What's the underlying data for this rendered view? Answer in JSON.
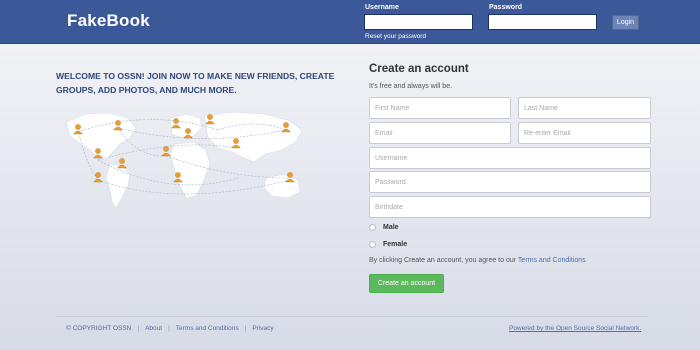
{
  "header": {
    "logo": "FakeBook",
    "username_label": "Username",
    "password_label": "Password",
    "username_value": "",
    "password_value": "",
    "reset_link": "Reset your password",
    "login_button": "Login",
    "bg_color": "#3b5998"
  },
  "welcome": {
    "text": "WELCOME TO OSSN! JOIN NOW TO MAKE NEW FRIENDS, CREATE GROUPS, ADD PHOTOS, AND MUCH MORE."
  },
  "signup": {
    "title": "Create an account",
    "subtitle": "It's free and always will be.",
    "first_name_placeholder": "First Name",
    "last_name_placeholder": "Last Name",
    "email_placeholder": "Email",
    "reenter_email_placeholder": "Re-enter Email",
    "username_placeholder": "Username",
    "password_placeholder": "Password",
    "birthdate_placeholder": "Birthdate",
    "gender_options": [
      "Male",
      "Female"
    ],
    "terms_prefix": "By clicking Create an account, you agree to our",
    "terms_link": "Terms and Conditions",
    "create_button": "Create an account",
    "create_button_color": "#5cb85c"
  },
  "footer": {
    "copyright": "© COPYRIGHT OSSN",
    "links": [
      "About",
      "Terms and Conditions",
      "Privacy"
    ],
    "separator": "|",
    "powered_by": "Powered by the Open Source Social Network."
  },
  "icons": {
    "map": "world-map-icon",
    "person": "person-icon"
  }
}
